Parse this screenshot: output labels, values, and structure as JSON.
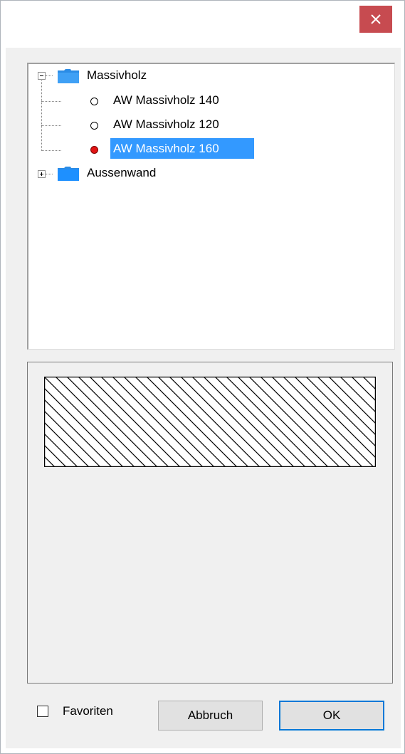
{
  "window": {
    "close_icon": "close-icon",
    "close_color": "#c74b50"
  },
  "tree": {
    "nodes": [
      {
        "label": "Massivholz",
        "expanded": true,
        "expander": "minus",
        "icon": "folder-open-icon",
        "children": [
          {
            "label": "AW Massivholz 140",
            "state": "inactive",
            "icon": "radio-empty-icon"
          },
          {
            "label": "AW Massivholz 120",
            "state": "inactive",
            "icon": "radio-empty-icon"
          },
          {
            "label": "AW Massivholz 160",
            "state": "active",
            "selected": true,
            "icon": "radio-red-icon"
          }
        ]
      },
      {
        "label": "Aussenwand",
        "expanded": false,
        "expander": "plus",
        "icon": "folder-closed-icon"
      }
    ],
    "selection_color": "#3399ff",
    "active_color": "#e11414"
  },
  "preview": {
    "pattern": "diagonal-hatch"
  },
  "footer": {
    "favorites_label": "Favoriten",
    "favorites_checked": false,
    "cancel_label": "Abbruch",
    "ok_label": "OK"
  }
}
